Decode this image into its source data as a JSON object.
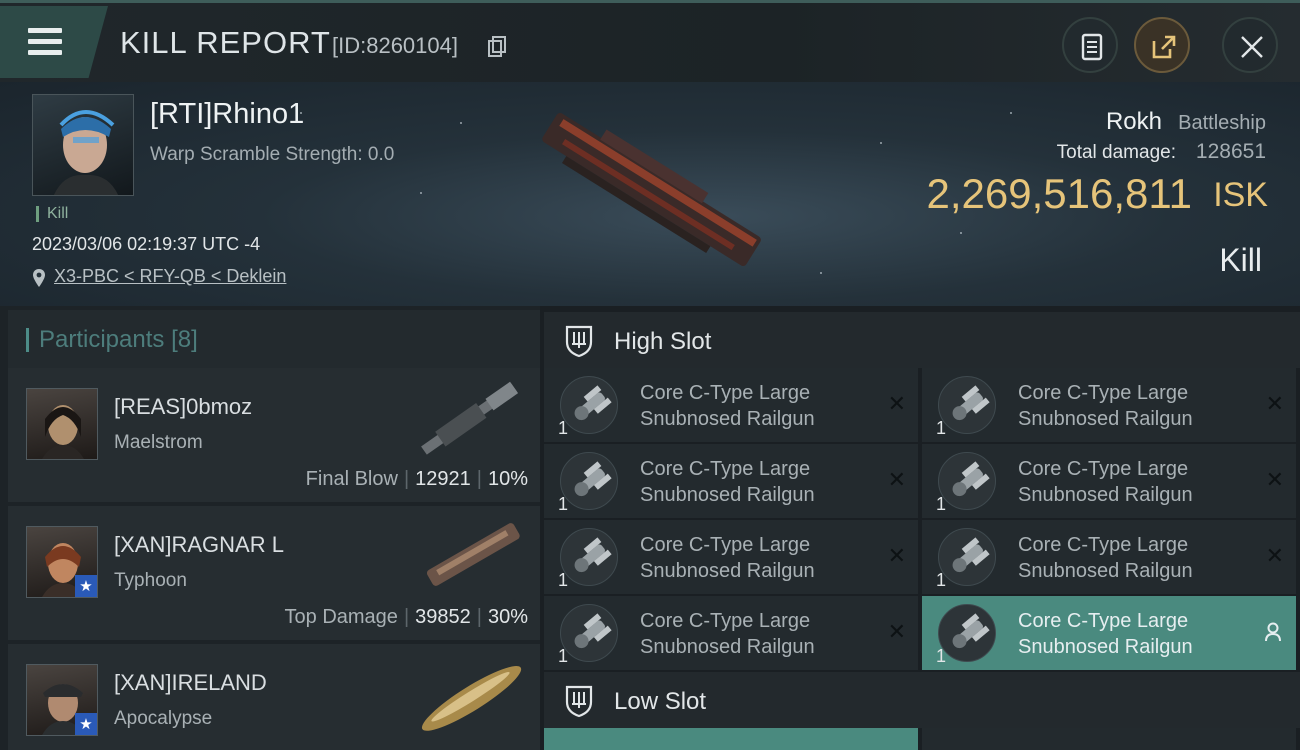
{
  "window": {
    "title": "KILL REPORT",
    "report_id": "[ID:8260104]"
  },
  "victim": {
    "name": "[RTI]Rhino1",
    "warp_scramble": "Warp Scramble Strength: 0.0",
    "tag": "Kill",
    "datetime": "2023/03/06 02:19:37 UTC -4",
    "location": "X3-PBC < RFY-QB < Deklein",
    "ship_name": "Rokh",
    "ship_class": "Battleship",
    "damage_label": "Total damage:",
    "damage_value": "128651",
    "isk_value": "2,269,516,811",
    "isk_unit": "ISK",
    "result": "Kill"
  },
  "participants": {
    "label": "Participants",
    "count": "[8]",
    "rows": [
      {
        "name": "[REAS]0bmoz",
        "ship": "Maelstrom",
        "tag": "Final Blow",
        "damage": "12921",
        "percent": "10%"
      },
      {
        "name": "[XAN]RAGNAR L",
        "ship": "Typhoon",
        "tag": "Top Damage",
        "damage": "39852",
        "percent": "30%"
      },
      {
        "name": "[XAN]IRELAND",
        "ship": "Apocalypse",
        "tag": "",
        "damage": "",
        "percent": ""
      }
    ]
  },
  "high_slot": {
    "label": "High Slot",
    "items": [
      {
        "qty": "1",
        "line1": "Core C-Type Large",
        "line2": "Snubnosed Railgun",
        "status": "destroyed"
      },
      {
        "qty": "1",
        "line1": "Core C-Type Large",
        "line2": "Snubnosed Railgun",
        "status": "destroyed"
      },
      {
        "qty": "1",
        "line1": "Core C-Type Large",
        "line2": "Snubnosed Railgun",
        "status": "destroyed"
      },
      {
        "qty": "1",
        "line1": "Core C-Type Large",
        "line2": "Snubnosed Railgun",
        "status": "destroyed"
      },
      {
        "qty": "1",
        "line1": "Core C-Type Large",
        "line2": "Snubnosed Railgun",
        "status": "destroyed"
      },
      {
        "qty": "1",
        "line1": "Core C-Type Large",
        "line2": "Snubnosed Railgun",
        "status": "destroyed"
      },
      {
        "qty": "1",
        "line1": "Core C-Type Large",
        "line2": "Snubnosed Railgun",
        "status": "destroyed"
      },
      {
        "qty": "1",
        "line1": "Core C-Type Large",
        "line2": "Snubnosed Railgun",
        "status": "dropped"
      }
    ]
  },
  "low_slot": {
    "label": "Low Slot"
  },
  "colors": {
    "accent_teal": "#4a8a7f",
    "isk_gold": "#e6c47a",
    "background": "#1a1f24"
  },
  "icons": {
    "menu": "hamburger-icon",
    "copy": "copy-icon",
    "report": "clipboard-icon",
    "share": "share-icon",
    "close": "close-icon",
    "location": "pin-icon",
    "slot": "shield-slot-icon",
    "destroyed": "x-icon",
    "dropped": "person-icon"
  }
}
